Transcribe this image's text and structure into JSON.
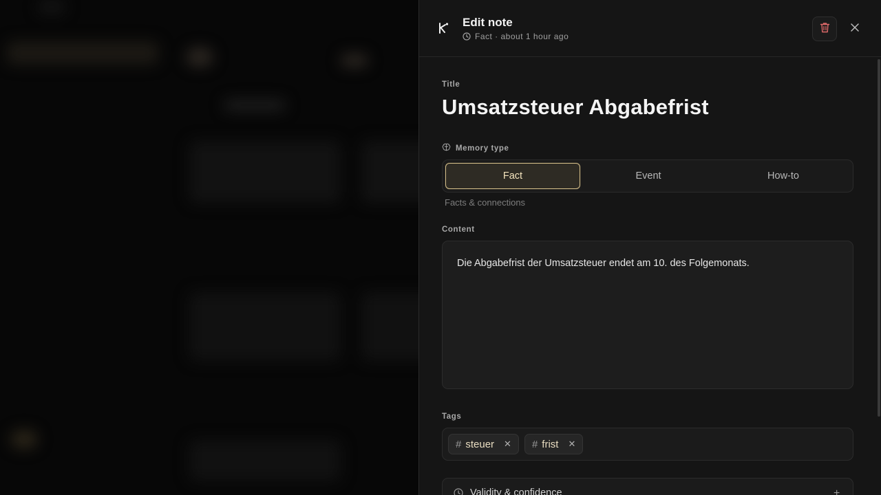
{
  "header": {
    "title": "Edit note",
    "meta": "Fact · about 1 hour ago",
    "delete_icon": "trash-icon",
    "close_icon": "close-icon"
  },
  "form": {
    "title_label": "Title",
    "title_value": "Umsatzsteuer Abgabefrist",
    "memory_type_label": "Memory type",
    "memory_types": [
      {
        "label": "Fact",
        "selected": true
      },
      {
        "label": "Event",
        "selected": false
      },
      {
        "label": "How-to",
        "selected": false
      }
    ],
    "memory_type_hint": "Facts & connections",
    "content_label": "Content",
    "content_value": "Die Abgabefrist der Umsatzsteuer endet am 10. des Folgemonats.",
    "tags_label": "Tags",
    "tags": [
      "steuer",
      "frist"
    ],
    "validity_label": "Validity & confidence"
  },
  "colors": {
    "accent_border": "#d6c08a",
    "accent_bg": "#2e2b24",
    "delete_icon": "#e06a6a"
  }
}
